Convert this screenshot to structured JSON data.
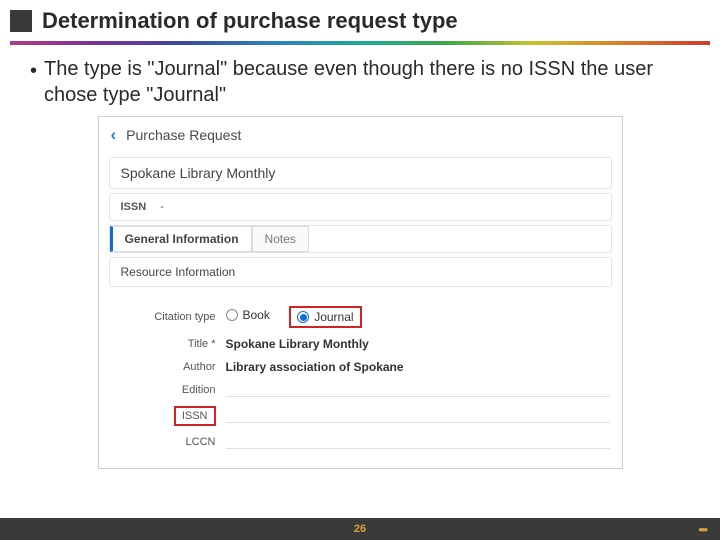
{
  "slide": {
    "title": "Determination of purchase request type",
    "bullet": "The type is \"Journal\" because even though there is no ISSN the user chose type \"Journal\"",
    "page_number": "26"
  },
  "card": {
    "back_icon": "‹",
    "title": "Purchase Request",
    "item_name": "Spokane Library Monthly",
    "issn_label": "ISSN",
    "issn_value": "-",
    "tabs": {
      "general": "General Information",
      "notes": "Notes"
    },
    "section": "Resource Information",
    "fields": {
      "citation_label": "Citation type",
      "book": "Book",
      "journal": "Journal",
      "title_label": "Title *",
      "title_value": "Spokane Library Monthly",
      "author_label": "Author",
      "author_value": "Library association of Spokane",
      "edition_label": "Edition",
      "issn_label": "ISSN",
      "lccn_label": "LCCN"
    }
  }
}
